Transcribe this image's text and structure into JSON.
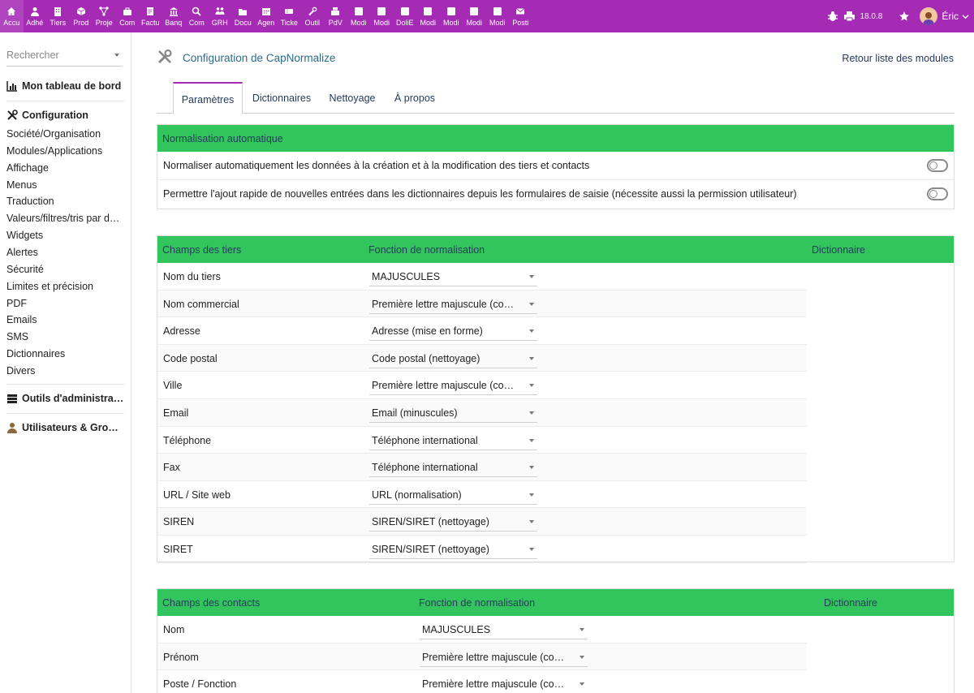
{
  "topmenu": [
    {
      "label": "Accu",
      "icon": "home-icon",
      "active": true
    },
    {
      "label": "Adhé",
      "icon": "member-icon"
    },
    {
      "label": "Tiers",
      "icon": "building-icon"
    },
    {
      "label": "Prod",
      "icon": "cube-icon"
    },
    {
      "label": "Proje",
      "icon": "project-icon"
    },
    {
      "label": "Com",
      "icon": "briefcase-icon"
    },
    {
      "label": "Factu",
      "icon": "invoice-icon"
    },
    {
      "label": "Banq",
      "icon": "bank-icon"
    },
    {
      "label": "Com",
      "icon": "search-icon"
    },
    {
      "label": "GRH",
      "icon": "hrm-icon"
    },
    {
      "label": "Docu",
      "icon": "folder-icon"
    },
    {
      "label": "Agen",
      "icon": "calendar-icon"
    },
    {
      "label": "Ticke",
      "icon": "ticket-icon"
    },
    {
      "label": "Outil",
      "icon": "wrench-icon"
    },
    {
      "label": "PdV",
      "icon": "cash-register-icon"
    },
    {
      "label": "Modi",
      "icon": "module-icon"
    },
    {
      "label": "Modi",
      "icon": "module-icon"
    },
    {
      "label": "DoliE",
      "icon": "module-icon"
    },
    {
      "label": "Modi",
      "icon": "module-icon"
    },
    {
      "label": "Modi",
      "icon": "module-icon"
    },
    {
      "label": "Modi",
      "icon": "module-icon"
    },
    {
      "label": "Modi",
      "icon": "module-icon"
    },
    {
      "label": "Posti",
      "icon": "mail-icon"
    }
  ],
  "topright": {
    "version": "18.0.8",
    "user": "Éric"
  },
  "sidebar": {
    "search_placeholder": "Rechercher",
    "dashboard": "Mon tableau de bord",
    "config": "Configuration",
    "config_items": [
      "Société/Organisation",
      "Modules/Applications",
      "Affichage",
      "Menus",
      "Traduction",
      "Valeurs/filtres/tris par défaut",
      "Widgets",
      "Alertes",
      "Sécurité",
      "Limites et précision",
      "PDF",
      "Emails",
      "SMS",
      "Dictionnaires",
      "Divers"
    ],
    "admin_tools": "Outils d'administration",
    "users_groups": "Utilisateurs & Groupes"
  },
  "header": {
    "title": "Configuration de CapNormalize",
    "back_link": "Retour liste des modules"
  },
  "tabs": [
    "Paramètres",
    "Dictionnaires",
    "Nettoyage",
    "À propos"
  ],
  "auto": {
    "title": "Normalisation automatique",
    "options": [
      {
        "label": "Normaliser automatiquement les données à la création et à la modification des tiers et contacts",
        "enabled": false
      },
      {
        "label": "Permettre l'ajout rapide de nouvelles entrées dans les dictionnaires depuis les formulaires de saisie (nécessite aussi la permission utilisateur)",
        "enabled": false
      }
    ]
  },
  "thirdparty": {
    "headers": [
      "Champs des tiers",
      "Fonction de normalisation",
      "Dictionnaire"
    ],
    "rows": [
      {
        "field": "Nom du tiers",
        "func": "MAJUSCULES"
      },
      {
        "field": "Nom commercial",
        "func": "Première lettre majuscule (composés)"
      },
      {
        "field": "Adresse",
        "func": "Adresse (mise en forme)"
      },
      {
        "field": "Code postal",
        "func": "Code postal (nettoyage)"
      },
      {
        "field": "Ville",
        "func": "Première lettre majuscule (composés)"
      },
      {
        "field": "Email",
        "func": "Email (minuscules)"
      },
      {
        "field": "Téléphone",
        "func": "Téléphone international"
      },
      {
        "field": "Fax",
        "func": "Téléphone international"
      },
      {
        "field": "URL / Site web",
        "func": "URL (normalisation)"
      },
      {
        "field": "SIREN",
        "func": "SIREN/SIRET (nettoyage)"
      },
      {
        "field": "SIRET",
        "func": "SIREN/SIRET (nettoyage)"
      }
    ]
  },
  "contacts": {
    "headers": [
      "Champs des contacts",
      "Fonction de normalisation",
      "Dictionnaire"
    ],
    "rows": [
      {
        "field": "Nom",
        "func": "MAJUSCULES"
      },
      {
        "field": "Prénom",
        "func": "Première lettre majuscule (composés)"
      },
      {
        "field": "Poste / Fonction",
        "func": "Première lettre majuscule (composés)"
      }
    ]
  }
}
